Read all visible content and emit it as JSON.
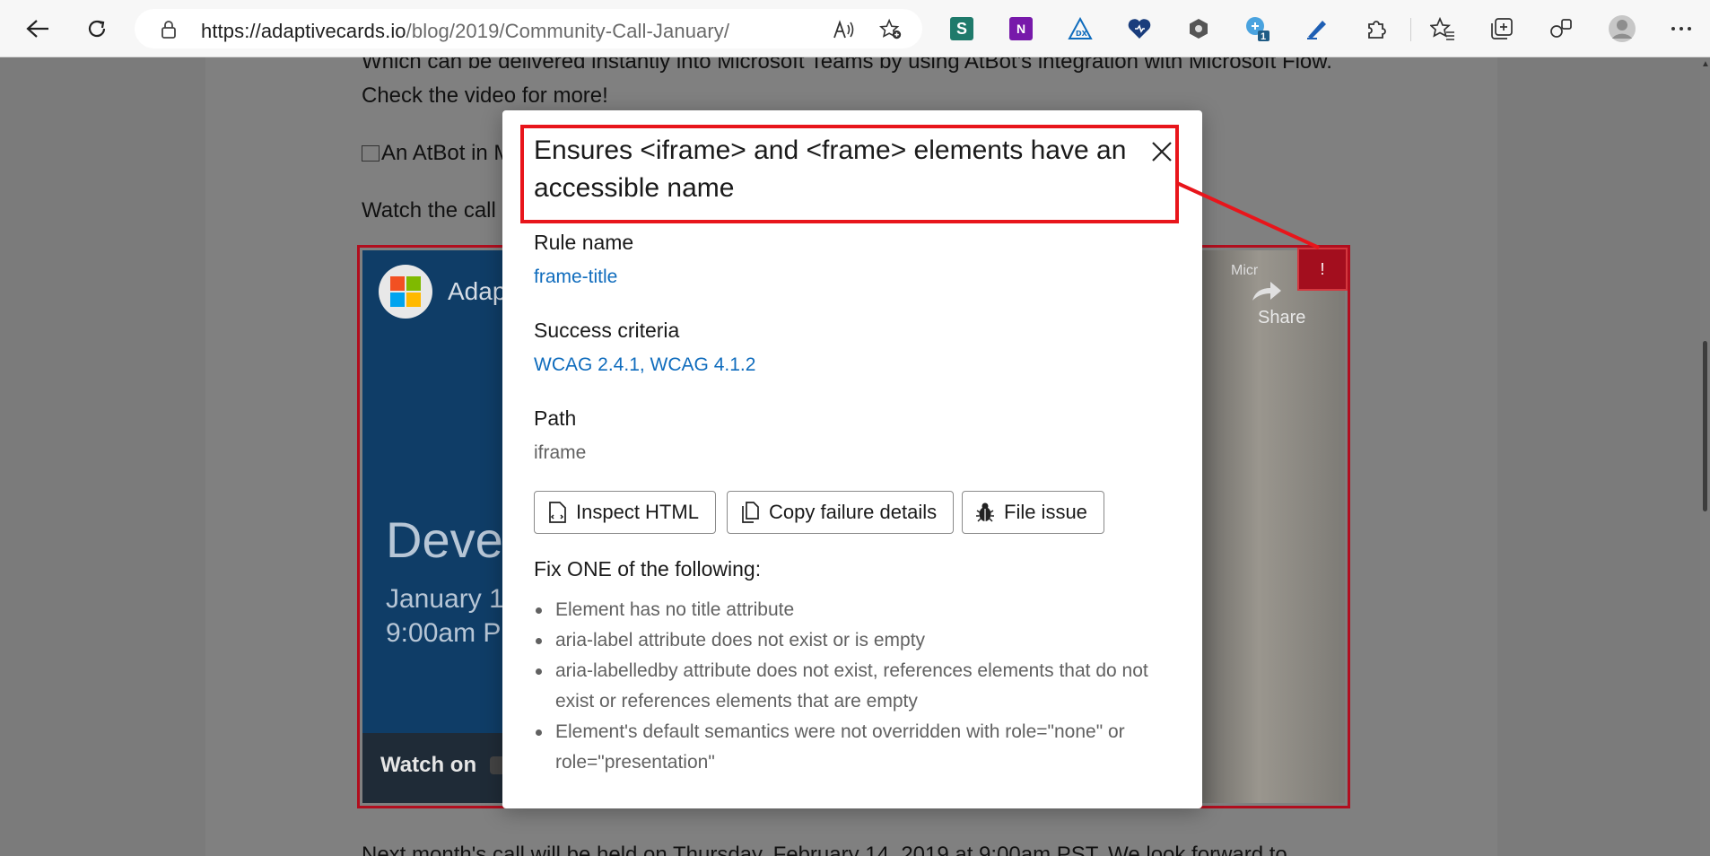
{
  "browser": {
    "url_domain": "https://adaptivecards.io",
    "url_path": "/blog/2019/Community-Call-January/",
    "badge_count": "1"
  },
  "article": {
    "line1": "Which can be delivered instantly into Microsoft Teams by using AtBot's integration with Microsoft Flow.",
    "line2": "Check the video for more!",
    "image_alt": "An AtBot in M",
    "watch_text": "Watch the call",
    "bottom_text": "Next month's call will be held on Thursday, February 14, 2019 at 9:00am PST.  We look forward to"
  },
  "video": {
    "title": "Adap",
    "big_text": "Devel",
    "date_line": "January 1",
    "time_line": "9:00am P",
    "watch_on": "Watch on",
    "share": "Share",
    "corner_brand": "Micr"
  },
  "error_badge": "!",
  "dialog": {
    "title": "Ensures <iframe> and <frame> elements have an accessible name",
    "rule_label": "Rule name",
    "rule_value": "frame-title",
    "criteria_label": "Success criteria",
    "criteria_value": "WCAG 2.4.1, WCAG 4.1.2",
    "path_label": "Path",
    "path_value": "iframe",
    "buttons": {
      "inspect": "Inspect HTML",
      "copy": "Copy failure details",
      "file": "File issue"
    },
    "fix_title": "Fix ONE of the following:",
    "fix_items": [
      "Element has no title attribute",
      "aria-label attribute does not exist or is empty",
      "aria-labelledby attribute does not exist, references elements that do not exist or references elements that are empty",
      "Element's default semantics were not overridden with role=\"none\" or role=\"presentation\""
    ]
  },
  "colors": {
    "accent_link": "#0f6cbd",
    "error_red": "#a30e1e",
    "highlight_red": "#e8151b"
  }
}
